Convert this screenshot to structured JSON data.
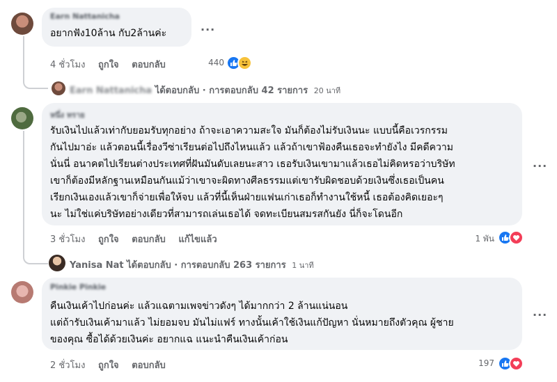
{
  "comments": [
    {
      "author": "Earn Nattanicha",
      "lines": [
        "อยากฟัง10ล้าน กับ2ล้านค่ะ"
      ],
      "time": "4 ชั่วโมง",
      "like": "ถูกใจ",
      "reply": "ตอบกลับ",
      "edited": "",
      "reaction_count": "440",
      "reactions": [
        "like-icon",
        "haha-icon"
      ]
    },
    {
      "author": "หนึ่ง ทราย",
      "lines": [
        "รับเงินไปแล้วเท่ากับยอมรับทุกอย่าง ถ้าจะเอาความสะใจ มันก็ต้องไม่รับเงินนะ แบบนี้คือเวรกรรม",
        "กันไปมาอ่ะ แล้วตอนนี้เรื่องวีซ่าเรียนต่อไปถึงไหนแล้ว แล้วถ้าเขาฟ้องคืนเธอจะทำยังไง มีคดีความ",
        "นั่นนี่ อนาคตไปเรียนต่างประเทศที่ฝันมันดับเลยนะสาว เธอรับเงินเขามาแล้วเธอไม่คิดหรอว่าบริษัท",
        "เขาก็ต้องมีหลักฐานเหมือนกันแม้ว่าเขาจะผิดทางศีลธรรมแต่เขารับผิดชอบด้วยเงินซึ่งเธอเป็นคน",
        "เรียกเงินเองแล้วเขาก็จ่ายเพื่อให้จบ แล้วที่นี้เห็นฝ่ายแฟนเก่าเธอก็ทำงานใช้หนี้ เธอต้องคิดเยอะๆ",
        "นะ ไม่ใช่แค่บริษัทอย่างเดียวที่สามารถเล่นเธอได้ จดทะเบียนสมรสกันยัง นี่ก็จะโดนอีก"
      ],
      "time": "3 ชั่วโมง",
      "like": "ถูกใจ",
      "reply": "ตอบกลับ",
      "edited": "แก้ไขแล้ว",
      "reaction_count": "1 พัน",
      "reactions": [
        "like-icon",
        "love-icon"
      ]
    },
    {
      "author": "Pinkie Pinkie",
      "lines": [
        "คืนเงินเค้าไปก่อนค่ะ แล้วแฉตามเพจข่าวดังๆ ได้มากกว่า 2 ล้านแน่นอน",
        "แต่ถ้ารับเงินเค้ามาแล้ว ไม่ยอมจบ มันไม่แฟร์ ทางนั้นเค้าใช้เงินแก้ปัญหา นั่นหมายถึงตัวคุณ ผู้ชาย",
        "ของคุณ ซื้อได้ด้วยเงินค่ะ อยากแฉ แนะนำคืนเงินเค้าก่อน"
      ],
      "time": "2 ชั่วโมง",
      "like": "ถูกใจ",
      "reply": "ตอบกลับ",
      "edited": "",
      "reaction_count": "197",
      "reactions": [
        "like-icon",
        "love-icon"
      ]
    }
  ],
  "replies": [
    {
      "name": "Earn Nattanicha",
      "text": "ได้ตอบกลับ · การตอบกลับ 42 รายการ",
      "time": "20 นาที"
    },
    {
      "name": "Yanisa Nat",
      "text": "ได้ตอบกลับ · การตอบกลับ 263 รายการ",
      "time": "1 นาที"
    }
  ],
  "more_glyph": "···",
  "colors": {
    "bubble": "#f0f2f5",
    "meta": "#65676b",
    "like": "#1877f2",
    "love": "#f33e58",
    "haha": "#f7c23a"
  }
}
